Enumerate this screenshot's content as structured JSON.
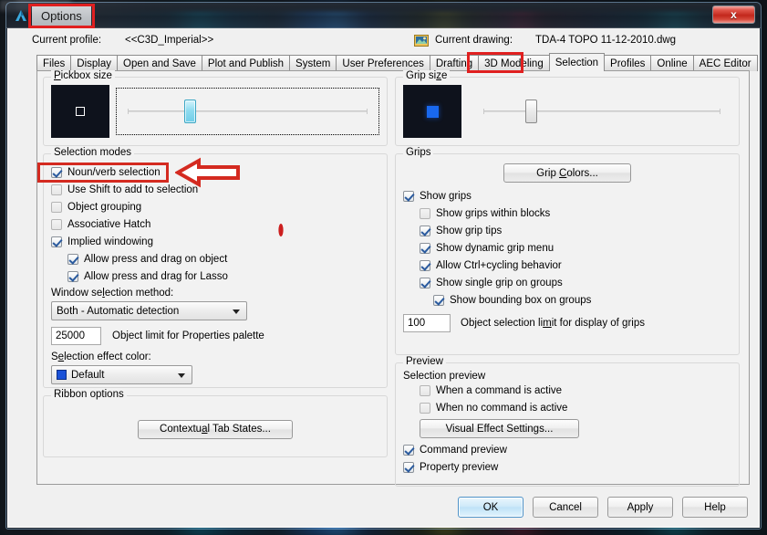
{
  "window": {
    "title": "Options",
    "app_icon": "autocad-logo-icon",
    "close_label": "x"
  },
  "header": {
    "profile_label": "Current profile:",
    "profile_value": "<<C3D_Imperial>>",
    "drawing_label": "Current drawing:",
    "drawing_value": "TDA-4 TOPO 11-12-2010.dwg",
    "drawing_icon": "drawing-file-icon"
  },
  "tabs": [
    {
      "label": "Files",
      "active": false
    },
    {
      "label": "Display",
      "active": false
    },
    {
      "label": "Open and Save",
      "active": false
    },
    {
      "label": "Plot and Publish",
      "active": false
    },
    {
      "label": "System",
      "active": false
    },
    {
      "label": "User Preferences",
      "active": false
    },
    {
      "label": "Drafting",
      "active": false
    },
    {
      "label": "3D Modeling",
      "active": false
    },
    {
      "label": "Selection",
      "active": true
    },
    {
      "label": "Profiles",
      "active": false
    },
    {
      "label": "Online",
      "active": false
    },
    {
      "label": "AEC Editor",
      "active": false
    }
  ],
  "pickbox": {
    "legend": "Pickbox size",
    "slider_value_pct": 26
  },
  "selection_modes": {
    "legend": "Selection modes",
    "items": [
      {
        "label": "Noun/verb selection",
        "checked": true,
        "indent": 0
      },
      {
        "label": "Use Shift to add to selection",
        "checked": false,
        "indent": 0
      },
      {
        "label": "Object grouping",
        "checked": false,
        "indent": 0
      },
      {
        "label": "Associative Hatch",
        "checked": false,
        "indent": 0
      },
      {
        "label": "Implied windowing",
        "checked": true,
        "indent": 0
      },
      {
        "label": "Allow press and drag on object",
        "checked": true,
        "indent": 1
      },
      {
        "label": "Allow press and drag for Lasso",
        "checked": true,
        "indent": 1
      }
    ],
    "window_method_label": "Window selection method:",
    "window_method_value": "Both - Automatic detection",
    "object_limit_value": "25000",
    "object_limit_label": "Object limit for Properties palette",
    "effect_color_label": "Selection effect color:",
    "effect_color_value": "Default",
    "effect_color_hex": "#1b52d8"
  },
  "ribbon_options": {
    "legend": "Ribbon options",
    "button_label": "Contextual Tab States..."
  },
  "grip_size": {
    "legend": "Grip size",
    "slider_value_pct": 20,
    "grip_color_hex": "#1968ee"
  },
  "grips": {
    "legend": "Grips",
    "grip_colors_button": "Grip Colors...",
    "items": [
      {
        "label": "Show grips",
        "checked": true,
        "indent": 0
      },
      {
        "label": "Show grips within blocks",
        "checked": false,
        "indent": 1
      },
      {
        "label": "Show grip tips",
        "checked": true,
        "indent": 1
      },
      {
        "label": "Show dynamic grip menu",
        "checked": true,
        "indent": 1
      },
      {
        "label": "Allow Ctrl+cycling behavior",
        "checked": true,
        "indent": 1
      },
      {
        "label": "Show single grip on groups",
        "checked": true,
        "indent": 1
      },
      {
        "label": "Show bounding box on groups",
        "checked": true,
        "indent": 2
      }
    ],
    "selection_limit_value": "100",
    "selection_limit_label": "Object selection limit for display of grips"
  },
  "preview": {
    "legend": "Preview",
    "subheading": "Selection preview",
    "items": [
      {
        "label": "When a command is active",
        "checked": false,
        "indent": 1
      },
      {
        "label": "When no command is active",
        "checked": false,
        "indent": 1
      }
    ],
    "visual_effect_button": "Visual Effect Settings...",
    "items2": [
      {
        "label": "Command preview",
        "checked": true,
        "indent": 0
      },
      {
        "label": "Property preview",
        "checked": true,
        "indent": 0
      }
    ]
  },
  "footer": {
    "buttons": [
      {
        "label": "OK",
        "default": true
      },
      {
        "label": "Cancel",
        "default": false
      },
      {
        "label": "Apply",
        "default": false
      },
      {
        "label": "Help",
        "default": false
      }
    ]
  },
  "annotations": {
    "highlight_color": "#d42a20",
    "title_highlight": "Options",
    "tab_highlight": "Selection",
    "checkbox_highlight": "Noun/verb selection",
    "arrow_direction": "left"
  }
}
